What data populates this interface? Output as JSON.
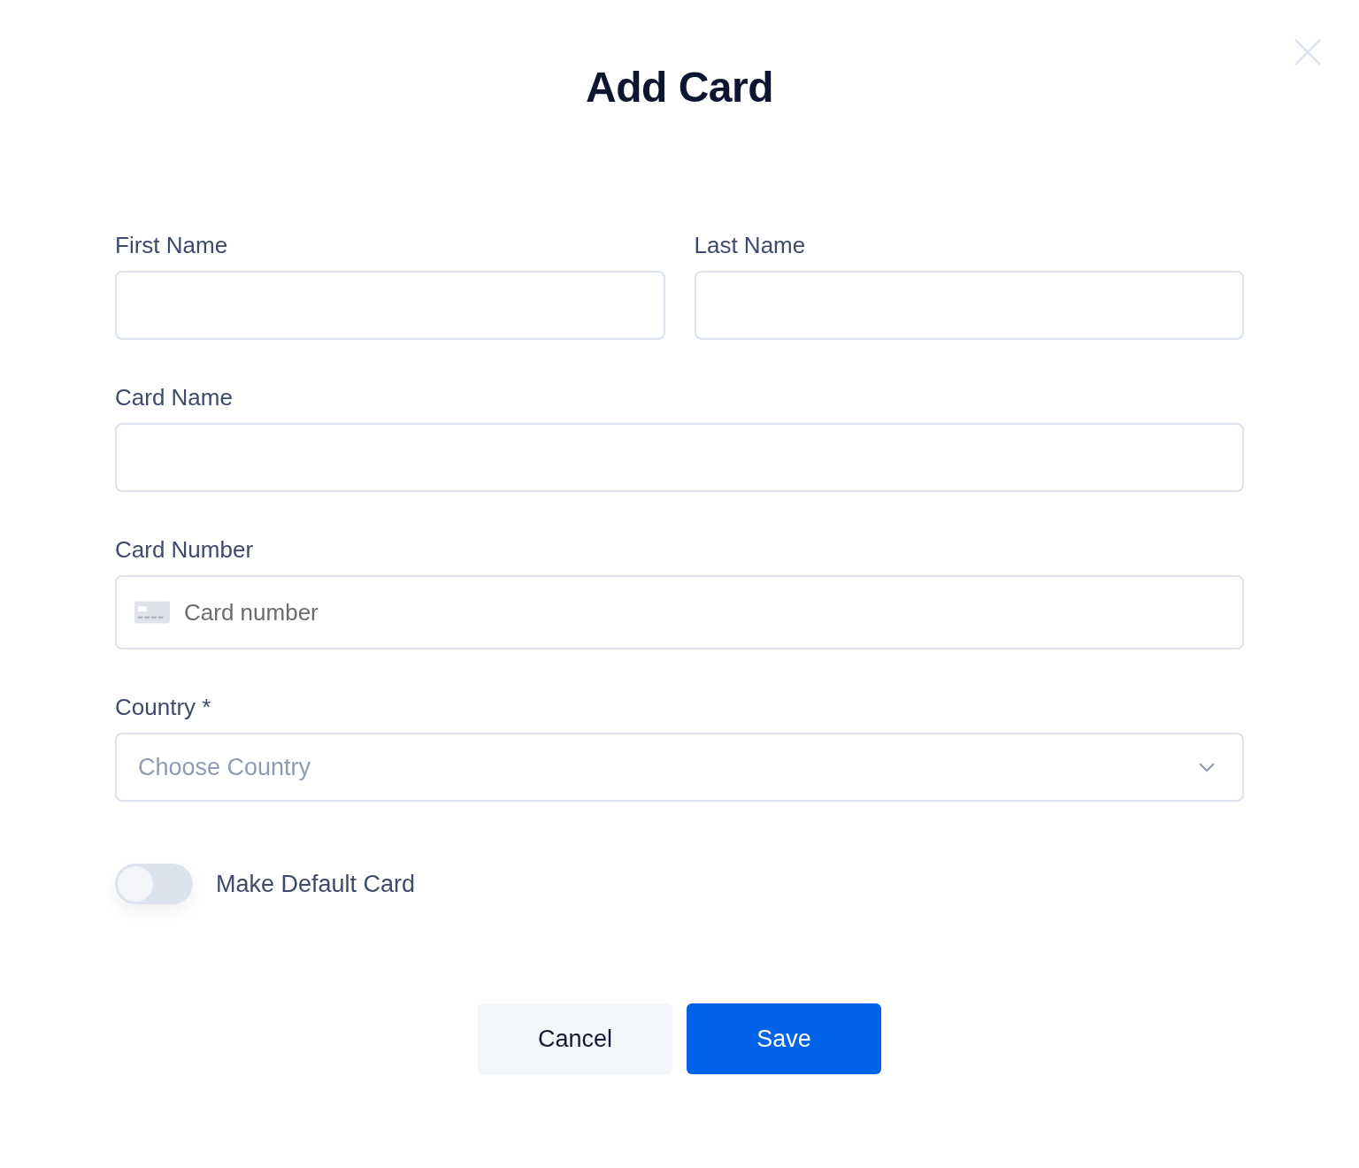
{
  "title": "Add Card",
  "rows": [
    [
      {
        "label": "First Name",
        "kind": "text"
      },
      {
        "label": "Last Name",
        "kind": "text"
      }
    ],
    [
      {
        "label": "Card Name",
        "kind": "text"
      }
    ],
    [
      {
        "label": "Card Number",
        "kind": "card",
        "placeholder": "Card number"
      }
    ],
    [
      {
        "label": "Country *",
        "kind": "select",
        "placeholder": "Choose Country"
      }
    ]
  ],
  "toggle": {
    "label": "Make Default Card",
    "on": false
  },
  "buttons": [
    {
      "label": "Cancel",
      "kind": "secondary"
    },
    {
      "label": "Save",
      "kind": "primary"
    }
  ]
}
